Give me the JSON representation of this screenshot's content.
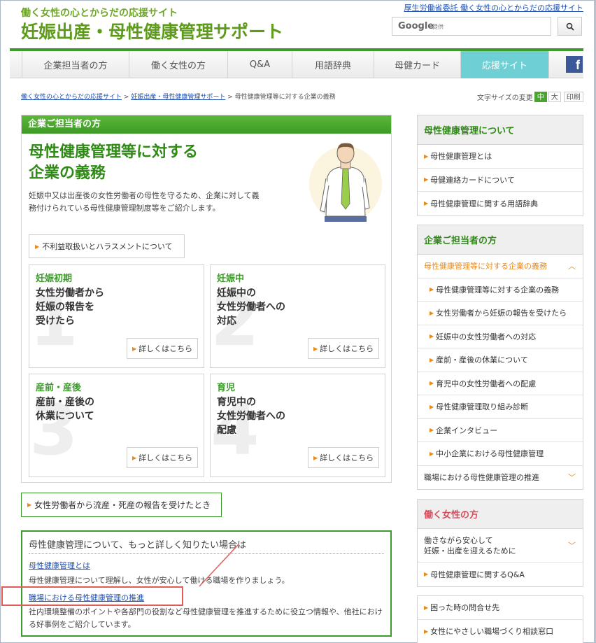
{
  "header": {
    "subtitle": "働く女性の心とからだの応援サイト",
    "title": "妊娠出産・母性健康管理サポート",
    "gov_link": "厚生労働省委託 働く女性の心とからだの応援サイト",
    "search": {
      "google_label": "Google",
      "provided": "提供",
      "icon": "search-icon"
    }
  },
  "nav": {
    "items": [
      "企業担当者の方",
      "働く女性の方",
      "Q&A",
      "用語辞典",
      "母健カード",
      "応援サイト"
    ],
    "active_index": 5,
    "facebook": "f"
  },
  "breadcrumb": {
    "items": [
      "働く女性の心とからだの応援サイト",
      "妊娠出産・母性健康管理サポート",
      "母性健康管理等に対する企業の義務"
    ],
    "separator": ">"
  },
  "font_size": {
    "label": "文字サイズの変更",
    "medium": "中",
    "large": "大",
    "print": "印刷"
  },
  "main": {
    "section_label": "企業ご担当者の方",
    "title_line1": "母性健康管理等に対する",
    "title_line2": "企業の義務",
    "description": "妊娠中又は出産後の女性労働者の母性を守るため、企業に対して義務付けられている母性健康管理制度等をご紹介します。",
    "harassment_button": "不利益取扱いとハラスメントについて",
    "cards": [
      {
        "num": "1",
        "label": "妊娠初期",
        "title_lines": [
          "女性労働者から",
          "妊娠の報告を",
          "受けたら"
        ],
        "more": "詳しくはこちら"
      },
      {
        "num": "2",
        "label": "妊娠中",
        "title_lines": [
          "妊娠中の",
          "女性労働者への",
          "対応"
        ],
        "more": "詳しくはこちら"
      },
      {
        "num": "3",
        "label": "産前・産後",
        "title_lines": [
          "産前・産後の",
          "休業について"
        ],
        "more": "詳しくはこちら"
      },
      {
        "num": "4",
        "label": "育児",
        "title_lines": [
          "育児中の",
          "女性労働者への",
          "配慮"
        ],
        "more": "詳しくはこちら"
      }
    ],
    "miscarriage_button": "女性労働者から流産・死産の報告を受けたとき"
  },
  "more_info": {
    "heading": "母性健康管理について、もっと詳しく知りたい場合は",
    "link1": "母性健康管理とは",
    "desc1": "母性健康管理について理解し、女性が安心して働ける職場を作りましょう。",
    "link2": "職場における母性健康管理の推進",
    "desc2": "社内環境整備のポイントや各部門の役割など母性健康管理を推進するために役立つ情報や、他社における好事例をご紹介しています。"
  },
  "sidebar": {
    "box1": {
      "heading": "母性健康管理について",
      "items": [
        "母性健康管理とは",
        "母健連絡カードについて",
        "母性健康管理に関する用語辞典"
      ]
    },
    "box2": {
      "heading": "企業ご担当者の方",
      "current": "母性健康管理等に対する企業の義務",
      "subitems": [
        "母性健康管理等に対する企業の義務",
        "女性労働者から妊娠の報告を受けたら",
        "妊娠中の女性労働者への対応",
        "産前・産後の休業について",
        "育児中の女性労働者への配慮",
        "母性健康管理取り組み診断",
        "企業インタビュー",
        "中小企業における母性健康管理"
      ],
      "last": "職場における母性健康管理の推進"
    },
    "box3": {
      "heading": "働く女性の方",
      "item1_line1": "働きながら安心して",
      "item1_line2": "妊娠・出産を迎えるために",
      "item2": "母性健康管理に関するQ&A"
    },
    "box4": {
      "items": [
        "困った時の問合せ先",
        "女性にやさしい職場づくり相談窓口"
      ]
    }
  },
  "colors": {
    "brand_green": "#3e9a2c",
    "accent_orange": "#e88a1a",
    "nav_active": "#6ecfd4",
    "annotation_red": "#e25b57"
  }
}
